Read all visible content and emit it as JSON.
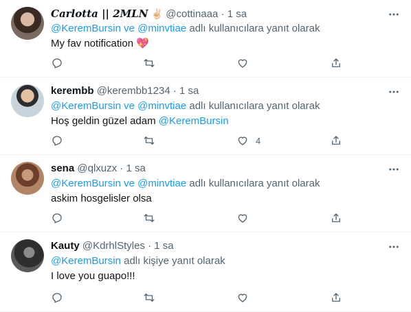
{
  "tweets": [
    {
      "name": "Carlotta || 2MLN",
      "name_emoji": "✌🏻",
      "handle": "@cottinaaa",
      "separator": "·",
      "time": "1 sa",
      "reply_mentions": "@KeremBursin ve @minvtiae",
      "reply_suffix": "adlı kullanıcılara yanıt olarak",
      "text": "My fav notification",
      "text_emoji": "💖",
      "like_count": ""
    },
    {
      "name": "kerembb",
      "handle": "@kerembb1234",
      "separator": "·",
      "time": "1 sa",
      "reply_mentions": "@KeremBursin ve @minvtiae",
      "reply_suffix": "adlı kullanıcılara yanıt olarak",
      "text": "Hoş geldin güzel adam",
      "text_mention": "@KeremBursin",
      "like_count": "4"
    },
    {
      "name": "sena",
      "handle": "@qlxuzx",
      "separator": "·",
      "time": "1 sa",
      "reply_mentions": "@KeremBursin ve @minvtiae",
      "reply_suffix": "adlı kullanıcılara yanıt olarak",
      "text": "askim hosgelisler olsa",
      "like_count": ""
    },
    {
      "name": "Kauty",
      "handle": "@KdrhlStyles",
      "separator": "·",
      "time": "1 sa",
      "reply_mentions": "@KeremBursin",
      "reply_suffix": "adlı kişiye yanıt olarak",
      "text": "I love you guapo!!!",
      "like_count": ""
    }
  ],
  "icons": {
    "reply": "reply-icon",
    "retweet": "retweet-icon",
    "like": "like-icon",
    "share": "share-icon",
    "more": "more-icon"
  },
  "colors": {
    "accent": "#1d9bf0",
    "secondary_text": "#536471",
    "divider": "#eff3f4"
  }
}
